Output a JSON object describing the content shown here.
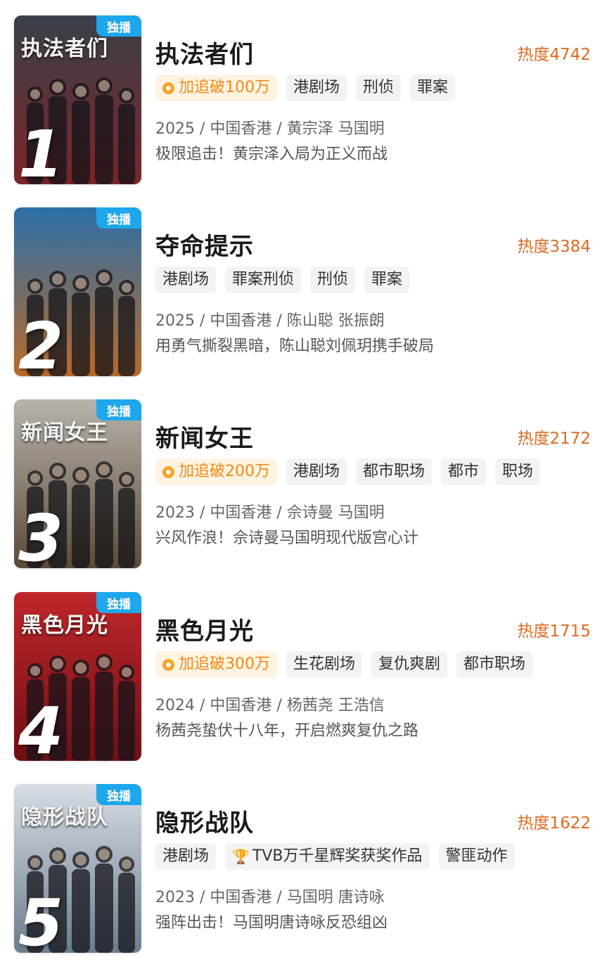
{
  "items": [
    {
      "poster_title": "执法者们",
      "badge": "独播",
      "rank": "1",
      "title": "执法者们",
      "heat": "热度4742",
      "promo": "加追破100万",
      "award": "",
      "tags": [
        "港剧场",
        "刑侦",
        "罪案"
      ],
      "meta": "2025 / 中国香港 / 黄宗泽 马国明",
      "desc": "极限追击！黄宗泽入局为正义而战",
      "colors": {
        "bg_top": "#3a4048",
        "bg_bottom": "#7a2428"
      }
    },
    {
      "poster_title": "",
      "badge": "独播",
      "rank": "2",
      "title": "夺命提示",
      "heat": "热度3384",
      "promo": "",
      "award": "",
      "tags": [
        "港剧场",
        "罪案刑侦",
        "刑侦",
        "罪案"
      ],
      "meta": "2025 / 中国香港 / 陈山聪 张振朗",
      "desc": "用勇气撕裂黑暗，陈山聪刘佩玥携手破局",
      "colors": {
        "bg_top": "#2b6fa8",
        "bg_bottom": "#b86a2a"
      }
    },
    {
      "poster_title": "新闻女王",
      "badge": "独播",
      "rank": "3",
      "title": "新闻女王",
      "heat": "热度2172",
      "promo": "加追破200万",
      "award": "",
      "tags": [
        "港剧场",
        "都市职场",
        "都市",
        "职场"
      ],
      "meta": "2023 / 中国香港 / 佘诗曼 马国明",
      "desc": "兴风作浪！佘诗曼马国明现代版宫心计",
      "colors": {
        "bg_top": "#b8b4ac",
        "bg_bottom": "#5a4a38"
      }
    },
    {
      "poster_title": "黑色月光",
      "badge": "独播",
      "rank": "4",
      "title": "黑色月光",
      "heat": "热度1715",
      "promo": "加追破300万",
      "award": "",
      "tags": [
        "生花剧场",
        "复仇爽剧",
        "都市职场"
      ],
      "meta": "2024 / 中国香港 / 杨茜尧 王浩信",
      "desc": "杨茜尧蛰伏十八年，开启燃爽复仇之路",
      "colors": {
        "bg_top": "#c0262a",
        "bg_bottom": "#6e0f14"
      }
    },
    {
      "poster_title": "隐形战队",
      "badge": "独播",
      "rank": "5",
      "title": "隐形战队",
      "heat": "热度1622",
      "promo": "",
      "award": "TVB万千星辉奖获奖作品",
      "tags": [
        "港剧场",
        "警匪动作"
      ],
      "meta": "2023 / 中国香港 / 马国明 唐诗咏",
      "desc": "强阵出击！马国明唐诗咏反恐组凶",
      "colors": {
        "bg_top": "#d8dde4",
        "bg_bottom": "#6b7c8e"
      }
    }
  ],
  "icons": {
    "promo": "circle-icon",
    "award": "trophy-icon"
  },
  "accent": {
    "heat": "#e06a20",
    "badge": "#1ea7ea",
    "promo": "#f08a1c"
  }
}
